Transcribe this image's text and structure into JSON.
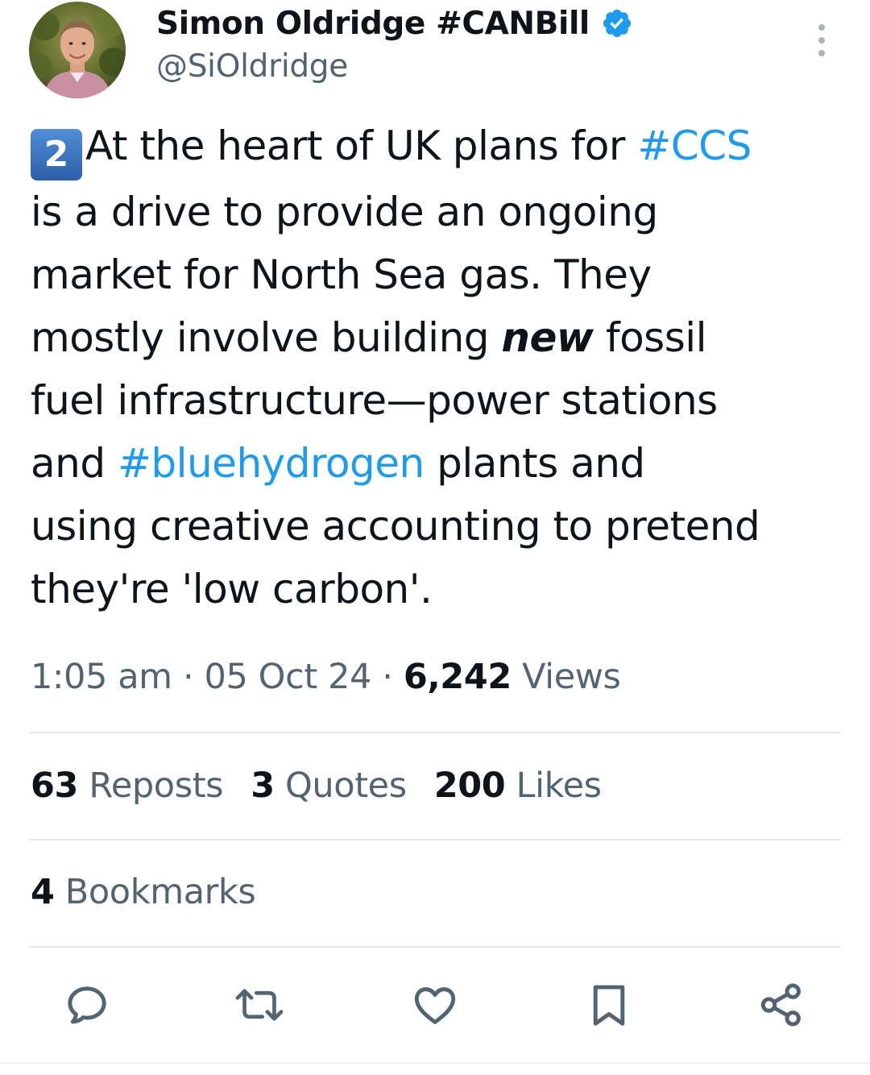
{
  "author": {
    "display_name": "Simon Oldridge #CANBill",
    "handle": "@SiOldridge",
    "verified": true,
    "avatar_icon": "profile-photo",
    "verified_color": "#1d9bf0"
  },
  "tweet": {
    "number_emoji": "2",
    "segments": [
      {
        "text": "At the heart of UK plans for ",
        "style": "normal"
      },
      {
        "text": "#CCS",
        "style": "hashtag"
      },
      {
        "text": "\nis a drive to provide an ongoing\nmarket for North Sea gas. They\nmostly involve building ",
        "style": "normal"
      },
      {
        "text": "new",
        "style": "emphasis"
      },
      {
        "text": " fossil\nfuel infrastructure—power stations\nand ",
        "style": "normal"
      },
      {
        "text": "#bluehydrogen",
        "style": "hashtag"
      },
      {
        "text": " plants and\nusing creative accounting to pretend\nthey're 'low carbon'.",
        "style": "normal"
      }
    ],
    "hashtag_color": "#1d9bf0"
  },
  "meta": {
    "time": "1:05 am",
    "separator": " · ",
    "date": "05 Oct 24",
    "views_count": "6,242",
    "views_label": " Views"
  },
  "stats": {
    "reposts_count": "63",
    "reposts_label": " Reposts",
    "quotes_count": "3",
    "quotes_label": " Quotes",
    "likes_count": "200",
    "likes_label": " Likes",
    "bookmarks_count": "4",
    "bookmarks_label": " Bookmarks"
  },
  "actions": [
    {
      "name": "reply",
      "icon": "speech-bubble-icon"
    },
    {
      "name": "repost",
      "icon": "repost-arrows-icon"
    },
    {
      "name": "like",
      "icon": "heart-icon"
    },
    {
      "name": "bookmark",
      "icon": "bookmark-icon"
    },
    {
      "name": "share",
      "icon": "share-nodes-icon"
    }
  ],
  "colors": {
    "text": "#0f1419",
    "secondary": "#536471",
    "accent": "#1d9bf0",
    "divider": "#e4e8eb"
  }
}
